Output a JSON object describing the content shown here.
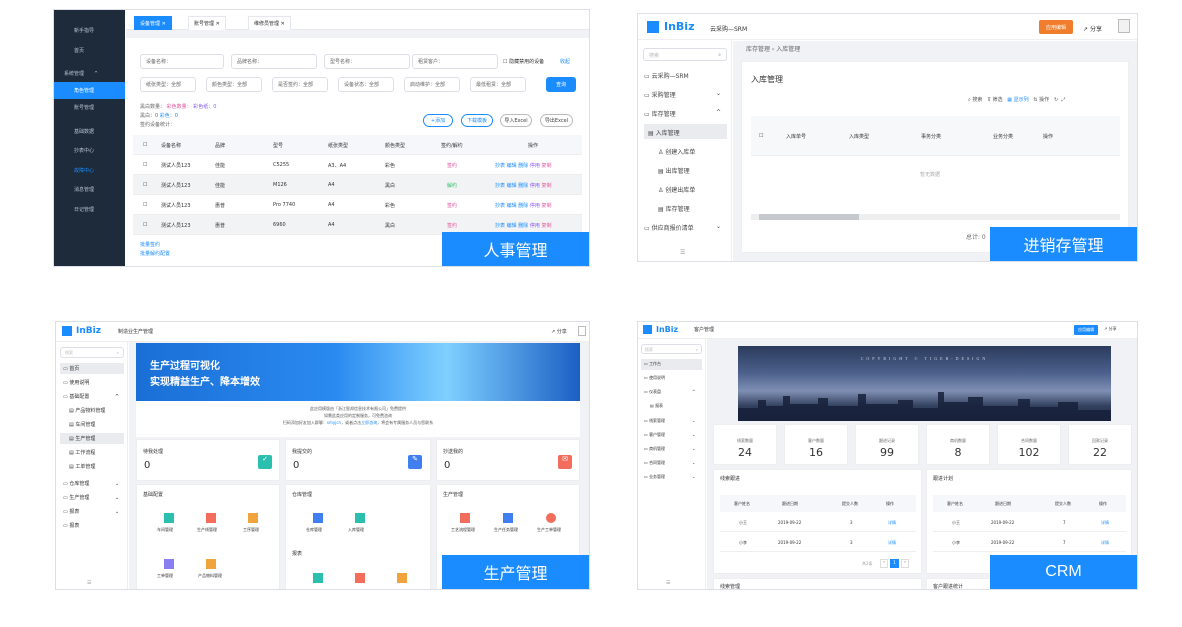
{
  "captions": {
    "hr": "人事管理",
    "inventory": "进销存管理",
    "production": "生产管理",
    "crm": "CRM"
  },
  "hr": {
    "sidebar": [
      "新手指导",
      "首页",
      "系统管理",
      "角色管理",
      "账号管理",
      "基础数据",
      "抄表中心",
      "故障中心",
      "消息管理",
      "日记管理"
    ],
    "tabs": [
      "设备管理",
      "账号管理",
      "维修员管理"
    ],
    "filters1": [
      "设备名称：",
      "品牌名称：",
      "型号名称：",
      "租赁客户："
    ],
    "hide_disabled": "隐藏禁用的设备",
    "collapse": "收起",
    "filters2": [
      "纸张类型：全部",
      "颜色类型：全部",
      "是否签约：全部",
      "设备状态：全部",
      "启动维护：全部",
      "最低租赁：全部"
    ],
    "query_btn": "查询",
    "stats": [
      "黑白数量：",
      "彩色数量：",
      "彩色纸：0",
      "黑白：0",
      "彩色：0",
      "签约设备统计："
    ],
    "actions": [
      "+添加",
      "下载模板",
      "导入Excel",
      "导出Excel"
    ],
    "columns": [
      "设备名称",
      "品牌",
      "型号",
      "纸张类型",
      "颜色类型",
      "签约/解约",
      "操作"
    ],
    "rows": [
      [
        "测试人员123",
        "佳能",
        "C5255",
        "A3、A4",
        "彩色",
        "签约"
      ],
      [
        "测试人员123",
        "佳能",
        "M126",
        "A4",
        "黑白",
        "解约"
      ],
      [
        "测试人员123",
        "惠普",
        "Pro 7740",
        "A4",
        "彩色",
        "签约"
      ],
      [
        "测试人员123",
        "惠普",
        "6960",
        "A4",
        "黑白",
        "签约"
      ]
    ],
    "row_ops": [
      "抄表",
      "编辑",
      "删除",
      "停用",
      "复制"
    ],
    "footer_links": [
      "批量签约",
      "批量解约配置"
    ]
  },
  "inv": {
    "brand": "InBiz",
    "app": "云采购—SRM",
    "publish": "应用编辑",
    "share": "分享",
    "search_placeholder": "搜索",
    "side": [
      "云采购—SRM",
      "采购管理",
      "库存管理",
      "入库管理",
      "创建入库单",
      "出库管理",
      "创建出库单",
      "库存管理",
      "供应商报价清单"
    ],
    "breadcrumb": [
      "库存管理",
      "入库管理"
    ],
    "page_title": "入库管理",
    "tools": [
      "搜索",
      "筛选",
      "显示列",
      "操作"
    ],
    "columns": [
      "入库单号",
      "入库类型",
      "事务分类",
      "业务分类",
      "操作"
    ],
    "empty": "暂无数据",
    "total": "总计: 0"
  },
  "prod": {
    "brand": "InBiz",
    "app": "制造业生产管理",
    "share": "分享",
    "search_placeholder": "搜索",
    "side": [
      "首页",
      "使用说明",
      "基础配置",
      "产品物料管理",
      "车间管理",
      "生产管理",
      "工作流程",
      "工单管理",
      "仓库管理",
      "生产管理",
      "报表",
      "报表"
    ],
    "banner_title": [
      "生产过程可视化",
      "实现精益生产、降本增效"
    ],
    "notice": [
      "此应用模版由「浙江智邦信息技术有限公司」免费提供",
      "如需此类应用的定制服务，可免费咨询",
      "扫码添加好友加入群聊：",
      "smyjcn",
      "，或者点击",
      "立即咨询",
      "，将会有专属服务人员与您联系"
    ],
    "stats": [
      {
        "label": "待我处理",
        "value": "0"
      },
      {
        "label": "我提交的",
        "value": "0"
      },
      {
        "label": "抄送我的",
        "value": "0"
      }
    ],
    "sections": [
      {
        "title": "基础配置",
        "items": [
          "车间管理",
          "生产线管理",
          "工序管理",
          "工单管理",
          "产品物料管理"
        ]
      },
      {
        "title": "仓库管理",
        "items": [
          "仓库管理",
          "入库管理"
        ]
      },
      {
        "title": "生产管理",
        "items": [
          "工艺流程管理",
          "生产任务管理",
          "生产工单管理"
        ]
      }
    ],
    "report": "报表",
    "colors": {
      "teal": "#2bbfb0",
      "blue": "#3f7ff0",
      "red": "#f26d5b",
      "orange": "#f0a43b",
      "purple": "#8a7ff0"
    }
  },
  "crm": {
    "brand": "InBiz",
    "app": "客户管理",
    "publish": "应用编辑",
    "share": "分享",
    "search_placeholder": "搜索",
    "side": [
      "工作台",
      "使用说明",
      "仪表盘",
      "报表",
      "线索管理",
      "客户管理",
      "商机管理",
      "合同管理",
      "业务管理"
    ],
    "banner_text": "COPYRIGHT © TIGER-DESIGN",
    "kpis": [
      {
        "label": "线索数量",
        "value": "24"
      },
      {
        "label": "客户数量",
        "value": "16"
      },
      {
        "label": "跟进记录",
        "value": "99"
      },
      {
        "label": "商机数量",
        "value": "8"
      },
      {
        "label": "合同数量",
        "value": "102"
      },
      {
        "label": "回款记录",
        "value": "22"
      }
    ],
    "left_title": "线索跟进",
    "right_title": "跟进计划",
    "columns": [
      "客户姓名",
      "跟进日期",
      "提交人数",
      "操作"
    ],
    "left_rows": [
      [
        "小王",
        "2019-09-22",
        "3",
        "详情"
      ],
      [
        "小李",
        "2019-09-22",
        "3",
        "详情"
      ]
    ],
    "right_rows": [
      [
        "小王",
        "2019-09-22",
        "7",
        "详情"
      ],
      [
        "小李",
        "2019-09-22",
        "7",
        "详情"
      ]
    ],
    "pager_total": "共2条",
    "page": "1",
    "bottom_titles": [
      "线索管理",
      "客户跟进统计"
    ]
  }
}
